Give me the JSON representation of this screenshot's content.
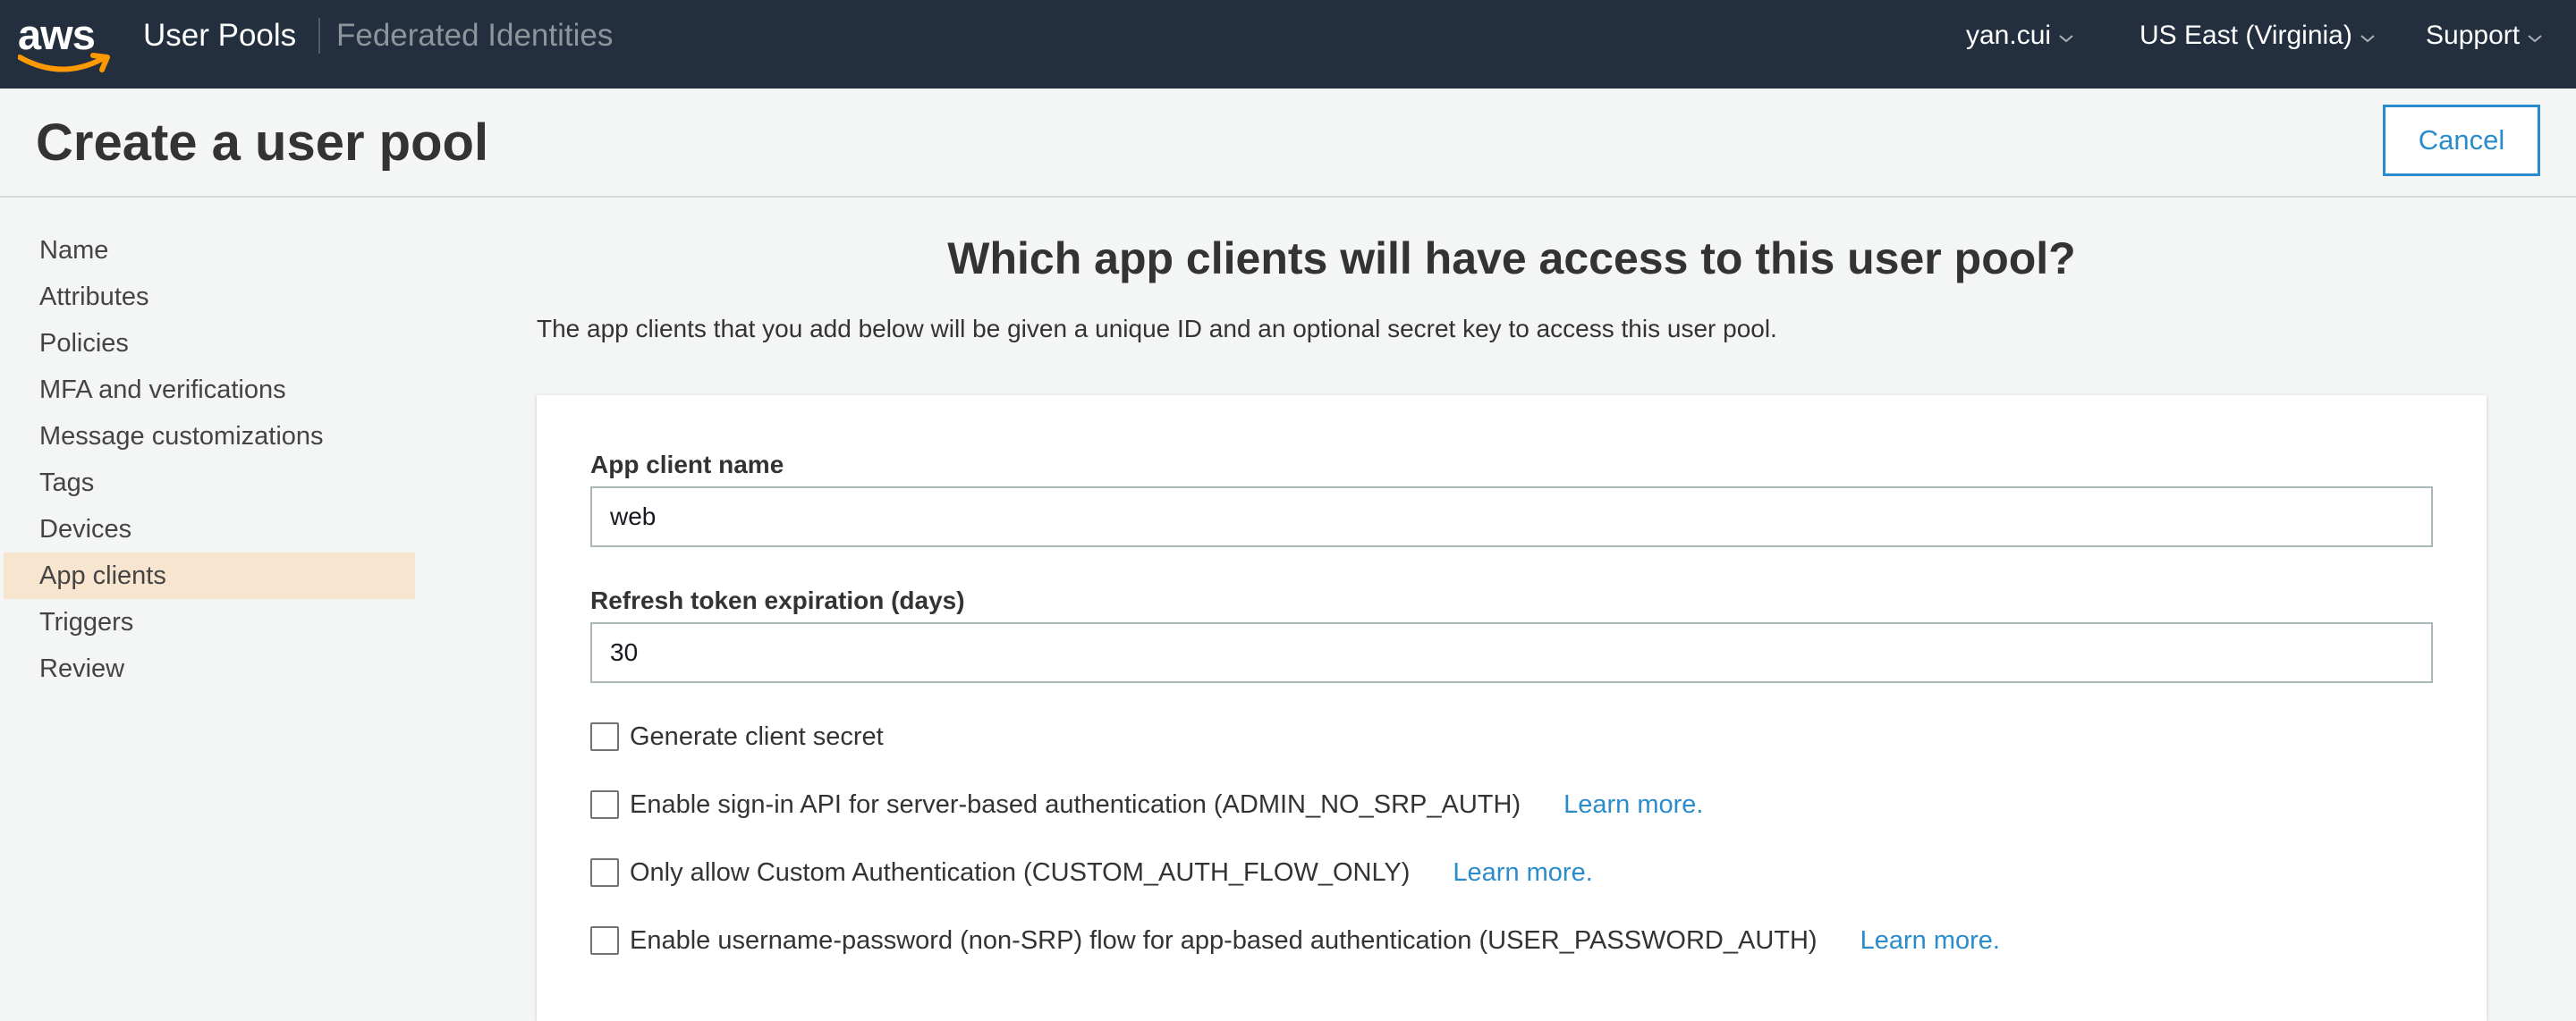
{
  "nav": {
    "logo_text": "aws",
    "user_pools": "User Pools",
    "federated_identities": "Federated Identities",
    "user": "yan.cui",
    "region": "US East (Virginia)",
    "support": "Support"
  },
  "header": {
    "title": "Create a user pool",
    "cancel_label": "Cancel"
  },
  "sidebar": {
    "items": [
      {
        "label": "Name"
      },
      {
        "label": "Attributes"
      },
      {
        "label": "Policies"
      },
      {
        "label": "MFA and verifications"
      },
      {
        "label": "Message customizations"
      },
      {
        "label": "Tags"
      },
      {
        "label": "Devices"
      },
      {
        "label": "App clients",
        "active": true
      },
      {
        "label": "Triggers"
      },
      {
        "label": "Review"
      }
    ]
  },
  "main": {
    "heading": "Which app clients will have access to this user pool?",
    "description": "The app clients that you add below will be given a unique ID and an optional secret key to access this user pool.",
    "app_client_name_label": "App client name",
    "app_client_name_value": "web",
    "refresh_token_label": "Refresh token expiration (days)",
    "refresh_token_value": "30",
    "options": [
      {
        "label": "Generate client secret",
        "checked": false,
        "learn_more": ""
      },
      {
        "label": "Enable sign-in API for server-based authentication (ADMIN_NO_SRP_AUTH)",
        "checked": false,
        "learn_more": "Learn more."
      },
      {
        "label": "Only allow Custom Authentication (CUSTOM_AUTH_FLOW_ONLY)",
        "checked": false,
        "learn_more": "Learn more."
      },
      {
        "label": "Enable username-password (non-SRP) flow for app-based authentication (USER_PASSWORD_AUTH)",
        "checked": false,
        "learn_more": "Learn more."
      }
    ]
  },
  "colors": {
    "nav_bg": "#232f3e",
    "accent": "#2b8ccb",
    "aws_orange": "#ff9900",
    "active_bg": "#f8e5cf"
  },
  "icons": {
    "logo": "aws-smile-logo",
    "dropdown": "chevron-down-icon"
  }
}
